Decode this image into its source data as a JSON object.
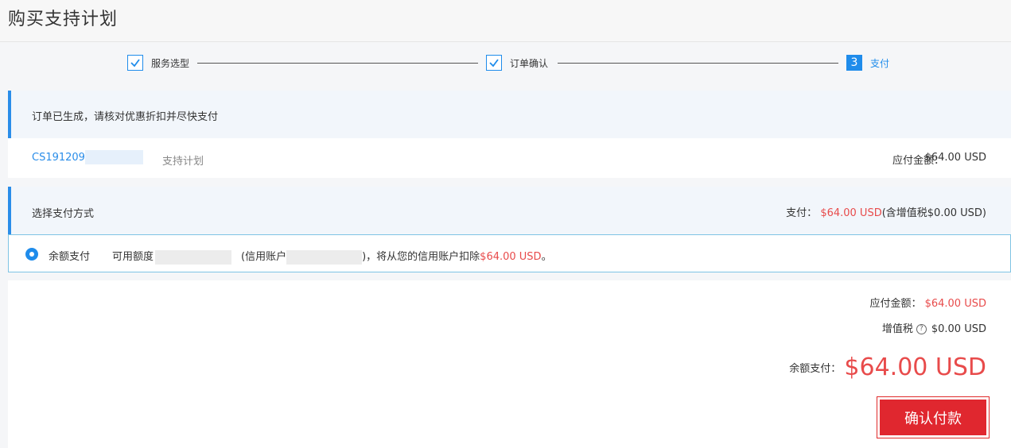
{
  "page": {
    "title": "购买支持计划"
  },
  "steps": [
    {
      "label": "服务选型",
      "state": "done"
    },
    {
      "label": "订单确认",
      "state": "done"
    },
    {
      "label": "支付",
      "number": "3",
      "state": "active"
    }
  ],
  "notice": {
    "text": "订单已生成，请核对优惠折扣并尽快支付"
  },
  "order": {
    "id_prefix": "CS191209",
    "type": "支持计划",
    "amount_label": "应付金额：",
    "amount_value": "$64.00 USD"
  },
  "payment_method": {
    "title": "选择支付方式",
    "summary_label": "支付：",
    "summary_amount": "$64.00 USD",
    "summary_tax": "(含增值税$0.00 USD)"
  },
  "option": {
    "label": "余额支付",
    "credit_label": "可用额度",
    "account_prefix": "(信用账户",
    "deduct_text": ")，将从您的信用账户扣除",
    "deduct_amount": "$64.00 USD",
    "deduct_suffix": "。"
  },
  "summary": {
    "due_label": "应付金额：",
    "due_value": "$64.00 USD",
    "tax_label": "增值税",
    "tax_value": "$0.00 USD",
    "balance_label": "余额支付：",
    "balance_value": "$64.00 USD",
    "confirm_label": "确认付款"
  },
  "colors": {
    "accent": "#1f8ceb",
    "price": "#e84b4b",
    "confirm": "#e0272f"
  }
}
